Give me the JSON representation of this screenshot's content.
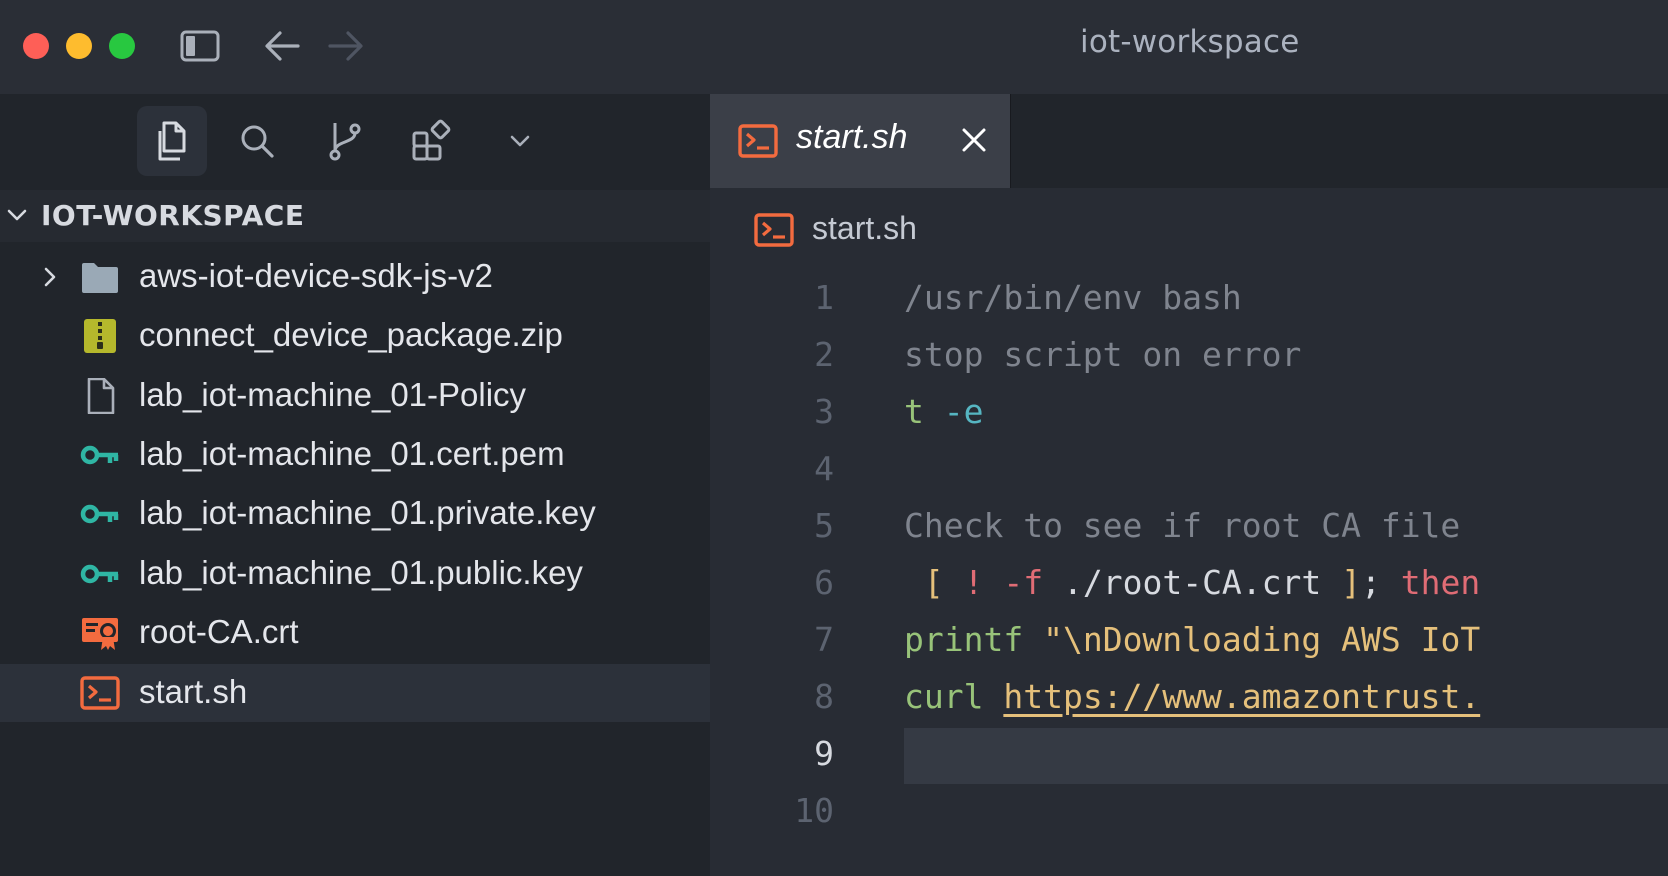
{
  "window": {
    "title": "iot-workspace"
  },
  "titlebar": {
    "icons": [
      "toggle-sidebar-icon",
      "back-arrow-icon",
      "forward-arrow-icon"
    ]
  },
  "activity_bar": {
    "items": [
      "explorer-icon",
      "search-icon",
      "source-control-icon",
      "extensions-icon",
      "chevron-down-icon"
    ],
    "active": "explorer"
  },
  "explorer": {
    "section_title": "IOT-WORKSPACE",
    "items": [
      {
        "label": "aws-iot-device-sdk-js-v2",
        "icon": "folder-icon"
      },
      {
        "label": "connect_device_package.zip",
        "icon": "zip-icon"
      },
      {
        "label": "lab_iot-machine_01-Policy",
        "icon": "file-icon"
      },
      {
        "label": "lab_iot-machine_01.cert.pem",
        "icon": "key-icon"
      },
      {
        "label": "lab_iot-machine_01.private.key",
        "icon": "key-icon"
      },
      {
        "label": "lab_iot-machine_01.public.key",
        "icon": "key-icon"
      },
      {
        "label": "root-CA.crt",
        "icon": "certificate-icon"
      },
      {
        "label": "start.sh",
        "icon": "terminal-icon",
        "selected": true
      }
    ]
  },
  "editor": {
    "tab": {
      "label": "start.sh"
    },
    "breadcrumb": "start.sh",
    "lines": [
      {
        "n": "1",
        "tokens": [
          {
            "t": "/usr/bin/env bash",
            "c": "comment"
          }
        ]
      },
      {
        "n": "2",
        "tokens": [
          {
            "t": "stop script on error",
            "c": "comment"
          }
        ]
      },
      {
        "n": "3",
        "tokens": [
          {
            "t": "t",
            "c": "green"
          },
          {
            "t": " ",
            "c": "white"
          },
          {
            "t": "-e",
            "c": "cyan"
          }
        ]
      },
      {
        "n": "4",
        "tokens": []
      },
      {
        "n": "5",
        "tokens": [
          {
            "t": "Check to see if root CA file ",
            "c": "comment"
          }
        ]
      },
      {
        "n": "6",
        "tokens": [
          {
            "t": " [",
            "c": "yellow"
          },
          {
            "t": " ",
            "c": "white"
          },
          {
            "t": "!",
            "c": "red"
          },
          {
            "t": " ",
            "c": "white"
          },
          {
            "t": "-f",
            "c": "red"
          },
          {
            "t": " ./root-CA.crt ",
            "c": "white"
          },
          {
            "t": "]",
            "c": "yellow"
          },
          {
            "t": "; ",
            "c": "white"
          },
          {
            "t": "then",
            "c": "red"
          }
        ]
      },
      {
        "n": "7",
        "tokens": [
          {
            "t": "printf",
            "c": "green"
          },
          {
            "t": " ",
            "c": "white"
          },
          {
            "t": "\"\\nDownloading AWS IoT",
            "c": "yellow"
          }
        ]
      },
      {
        "n": "8",
        "tokens": [
          {
            "t": "curl",
            "c": "green"
          },
          {
            "t": " ",
            "c": "white"
          },
          {
            "t": "https://www.amazontrust.",
            "c": "link"
          }
        ]
      },
      {
        "n": "9",
        "tokens": [],
        "current": true
      },
      {
        "n": "10",
        "tokens": []
      }
    ]
  }
}
